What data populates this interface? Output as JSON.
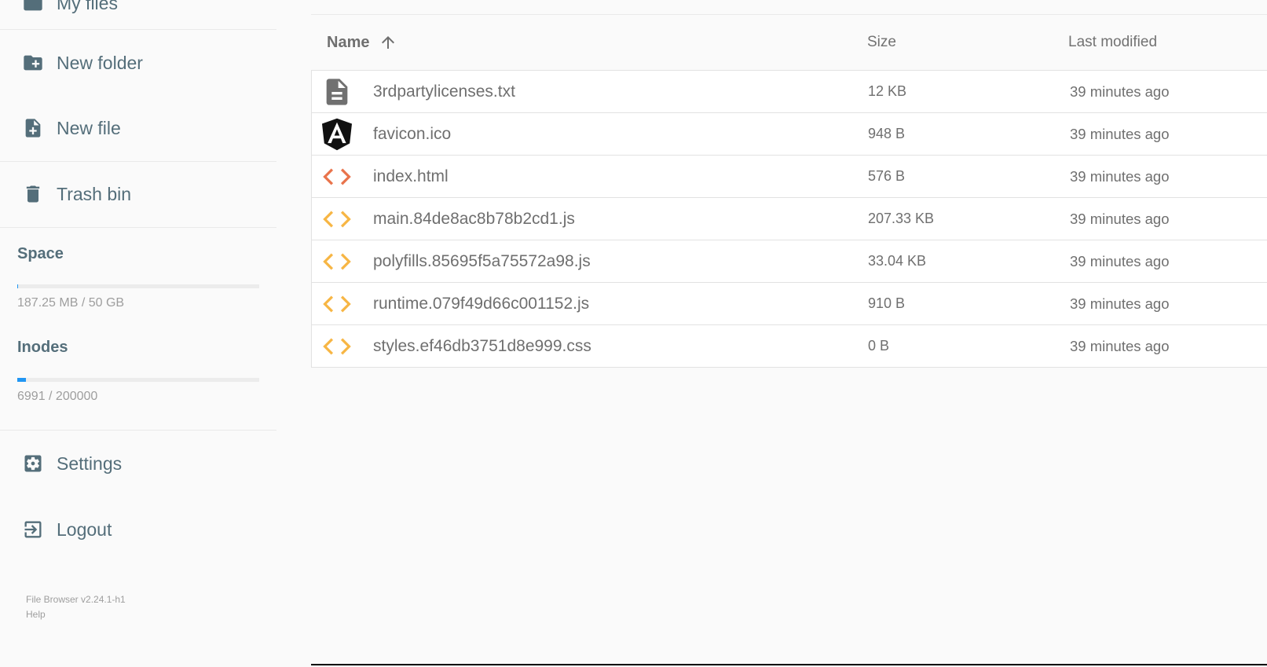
{
  "sidebar": {
    "nav": {
      "my_files": "My files",
      "new_folder": "New folder",
      "new_file": "New file",
      "trash_bin": "Trash bin",
      "settings": "Settings",
      "logout": "Logout"
    },
    "space": {
      "title": "Space",
      "used_text": "187.25 MB / 50 GB",
      "fill_percent": 0.37
    },
    "inodes": {
      "title": "Inodes",
      "used_text": "6991 / 200000",
      "fill_percent": 3.5
    },
    "footer": {
      "version": "File Browser v2.24.1-h1",
      "help": "Help"
    }
  },
  "listing": {
    "columns": {
      "name": "Name",
      "size": "Size",
      "modified": "Last modified"
    },
    "sort": {
      "column": "name",
      "direction": "ascending",
      "icon": "arrow-up-icon"
    },
    "files": [
      {
        "name": "3rdpartylicenses.txt",
        "size": "12 KB",
        "modified": "39 minutes ago",
        "icon": "text-file-icon"
      },
      {
        "name": "favicon.ico",
        "size": "948 B",
        "modified": "39 minutes ago",
        "icon": "angular-logo-icon"
      },
      {
        "name": "index.html",
        "size": "576 B",
        "modified": "39 minutes ago",
        "icon": "code-icon"
      },
      {
        "name": "main.84de8ac8b78b2cd1.js",
        "size": "207.33 KB",
        "modified": "39 minutes ago",
        "icon": "code-icon"
      },
      {
        "name": "polyfills.85695f5a75572a98.js",
        "size": "33.04 KB",
        "modified": "39 minutes ago",
        "icon": "code-icon"
      },
      {
        "name": "runtime.079f49d66c001152.js",
        "size": "910 B",
        "modified": "39 minutes ago",
        "icon": "code-icon"
      },
      {
        "name": "styles.ef46db3751d8e999.css",
        "size": "0 B",
        "modified": "39 minutes ago",
        "icon": "code-icon"
      }
    ]
  },
  "colors": {
    "sidebar_text": "#546e7a",
    "progress_fill": "#2196f3",
    "html_icon": "#e9744c",
    "js_icon": "#f7b645",
    "text_icon": "#707070"
  }
}
